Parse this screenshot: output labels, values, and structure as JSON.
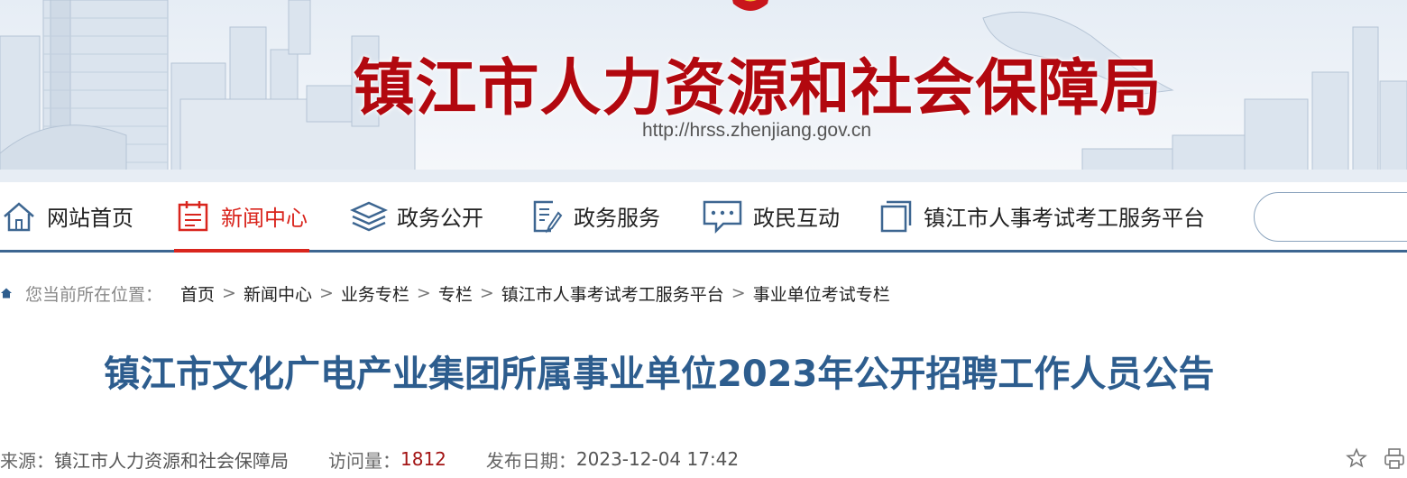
{
  "header": {
    "site_title": "镇江市人力资源和社会保障局",
    "site_url": "http://hrss.zhenjiang.gov.cn"
  },
  "nav": {
    "items": [
      {
        "label": "网站首页",
        "icon": "home-icon"
      },
      {
        "label": "新闻中心",
        "icon": "news-icon",
        "active": true
      },
      {
        "label": "政务公开",
        "icon": "layers-icon"
      },
      {
        "label": "政务服务",
        "icon": "edit-document-icon"
      },
      {
        "label": "政民互动",
        "icon": "chat-icon"
      },
      {
        "label": "镇江市人事考试考工服务平台",
        "icon": "window-icon"
      }
    ],
    "search_placeholder": ""
  },
  "breadcrumb": {
    "lead": "您当前所在位置：",
    "items": [
      "首页",
      "新闻中心",
      "业务专栏",
      "专栏",
      "镇江市人事考试考工服务平台",
      "事业单位考试专栏"
    ],
    "separator": ">"
  },
  "article": {
    "title": "镇江市文化广电产业集团所属事业单位2023年公开招聘工作人员公告",
    "source_label": "来源：",
    "source": "镇江市人力资源和社会保障局",
    "views_label": "访问量：",
    "views": "1812",
    "date_label": "发布日期：",
    "date": "2023-12-04 17:42"
  },
  "colors": {
    "title_red": "#b2080f",
    "nav_active": "#d9251d",
    "nav_rule": "#3d6691",
    "article_title": "#2d5d8e",
    "views": "#a31515"
  }
}
